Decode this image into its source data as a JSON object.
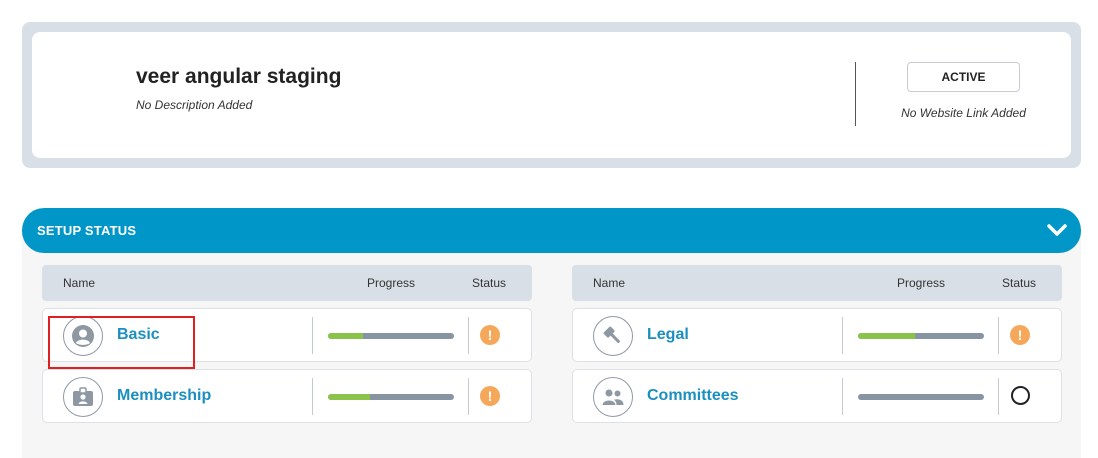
{
  "org": {
    "title": "veer angular staging",
    "description": "No Description Added",
    "status_label": "ACTIVE",
    "website_text": "No Website Link Added"
  },
  "setup": {
    "title": "SETUP STATUS",
    "columns": {
      "name": "Name",
      "progress": "Progress",
      "status": "Status"
    },
    "items": [
      {
        "label": "Basic",
        "icon": "user-circle-icon",
        "progress": 0.28,
        "status": "warning"
      },
      {
        "label": "Membership",
        "icon": "id-badge-icon",
        "progress": 0.33,
        "status": "warning"
      },
      {
        "label": "Legal",
        "icon": "gavel-icon",
        "progress": 0.45,
        "status": "warning"
      },
      {
        "label": "Committees",
        "icon": "group-icon",
        "progress": 0.0,
        "status": "incomplete"
      }
    ],
    "warning_glyph": "!"
  },
  "colors": {
    "accent": "#0096c8",
    "progress_fill": "#8bc34a",
    "progress_track": "#8795a3",
    "warning": "#f5a85a",
    "link": "#1b8fc0"
  }
}
